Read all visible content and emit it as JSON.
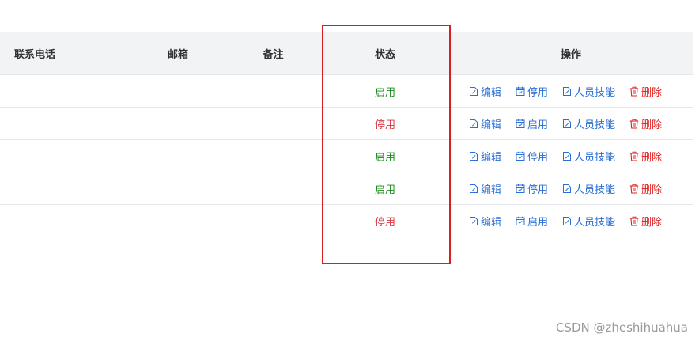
{
  "columns": {
    "phone": "联系电话",
    "email": "邮箱",
    "note": "备注",
    "status": "状态",
    "ops": "操作"
  },
  "rows": [
    {
      "status": "启用",
      "enabled": true,
      "toggle": "停用"
    },
    {
      "status": "停用",
      "enabled": false,
      "toggle": "启用"
    },
    {
      "status": "启用",
      "enabled": true,
      "toggle": "停用"
    },
    {
      "status": "启用",
      "enabled": true,
      "toggle": "停用"
    },
    {
      "status": "停用",
      "enabled": false,
      "toggle": "启用"
    }
  ],
  "actions": {
    "edit": "编辑",
    "skills": "人员技能",
    "delete": "删除"
  },
  "icons": {
    "edit": "edit-icon",
    "toggle": "calendar-check-icon",
    "skills": "document-edit-icon",
    "delete": "trash-icon"
  },
  "colors": {
    "enabled": "#1a8a1a",
    "disabled": "#d9363e",
    "link": "#2b6fd6",
    "danger": "#e02020",
    "highlight": "#d81e1e"
  },
  "watermark": "CSDN @zheshihuahua"
}
